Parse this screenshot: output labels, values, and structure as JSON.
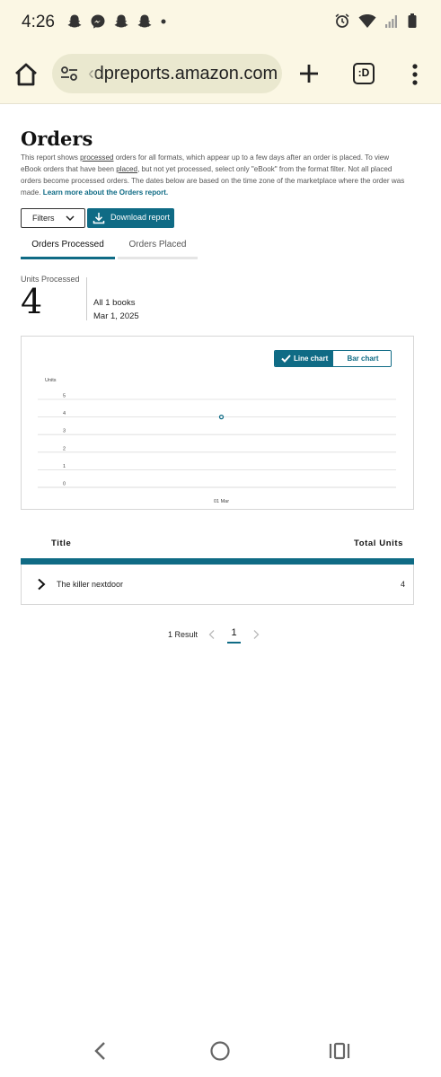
{
  "status_bar": {
    "time": "4:26"
  },
  "browser": {
    "url": "‹dpreports.amazon.com",
    "tab_count": ":D"
  },
  "page": {
    "title": "Orders",
    "description": {
      "part1": "This report shows ",
      "processed": "processed",
      "part2": " orders for all formats, which appear up to a few days after an order is placed. To view eBook orders that have been ",
      "placed": "placed",
      "part3": ", but not yet processed, select only \"eBook\" from the format filter. Not all placed orders become processed orders. The dates below are based on the time zone of the marketplace where the order was made. ",
      "learn_more": "Learn more about the Orders report."
    },
    "filters_label": "Filters",
    "download_label": "Download report",
    "tabs": [
      {
        "label": "Orders Processed",
        "active": true
      },
      {
        "label": "Orders Placed",
        "active": false
      }
    ],
    "summary": {
      "label": "Units Processed",
      "value": "4",
      "books": "All 1 books",
      "date": "Mar 1, 2025"
    },
    "chart_toggle": {
      "line_label": "Line chart",
      "bar_label": "Bar chart",
      "selected": "line"
    },
    "table": {
      "headers": {
        "title": "Title",
        "units": "Total Units"
      },
      "rows": [
        {
          "title": "The killer nextdoor",
          "units": "4"
        }
      ]
    },
    "pagination": {
      "result_text": "1 Result",
      "current_page": "1"
    }
  },
  "colors": {
    "accent": "#0f6b85",
    "browser_bg": "#fbf7e4",
    "url_bar": "#eae8cf"
  },
  "chart_data": {
    "type": "line",
    "ylabel": "Units",
    "xlabel": "",
    "ylim": [
      0,
      5
    ],
    "y_ticks": [
      "5",
      "4",
      "3",
      "2",
      "1",
      "0"
    ],
    "x_ticks": [
      "01 Mar"
    ],
    "grid": true,
    "series": [
      {
        "x": [
          "01 Mar"
        ],
        "values": [
          4
        ]
      }
    ]
  }
}
